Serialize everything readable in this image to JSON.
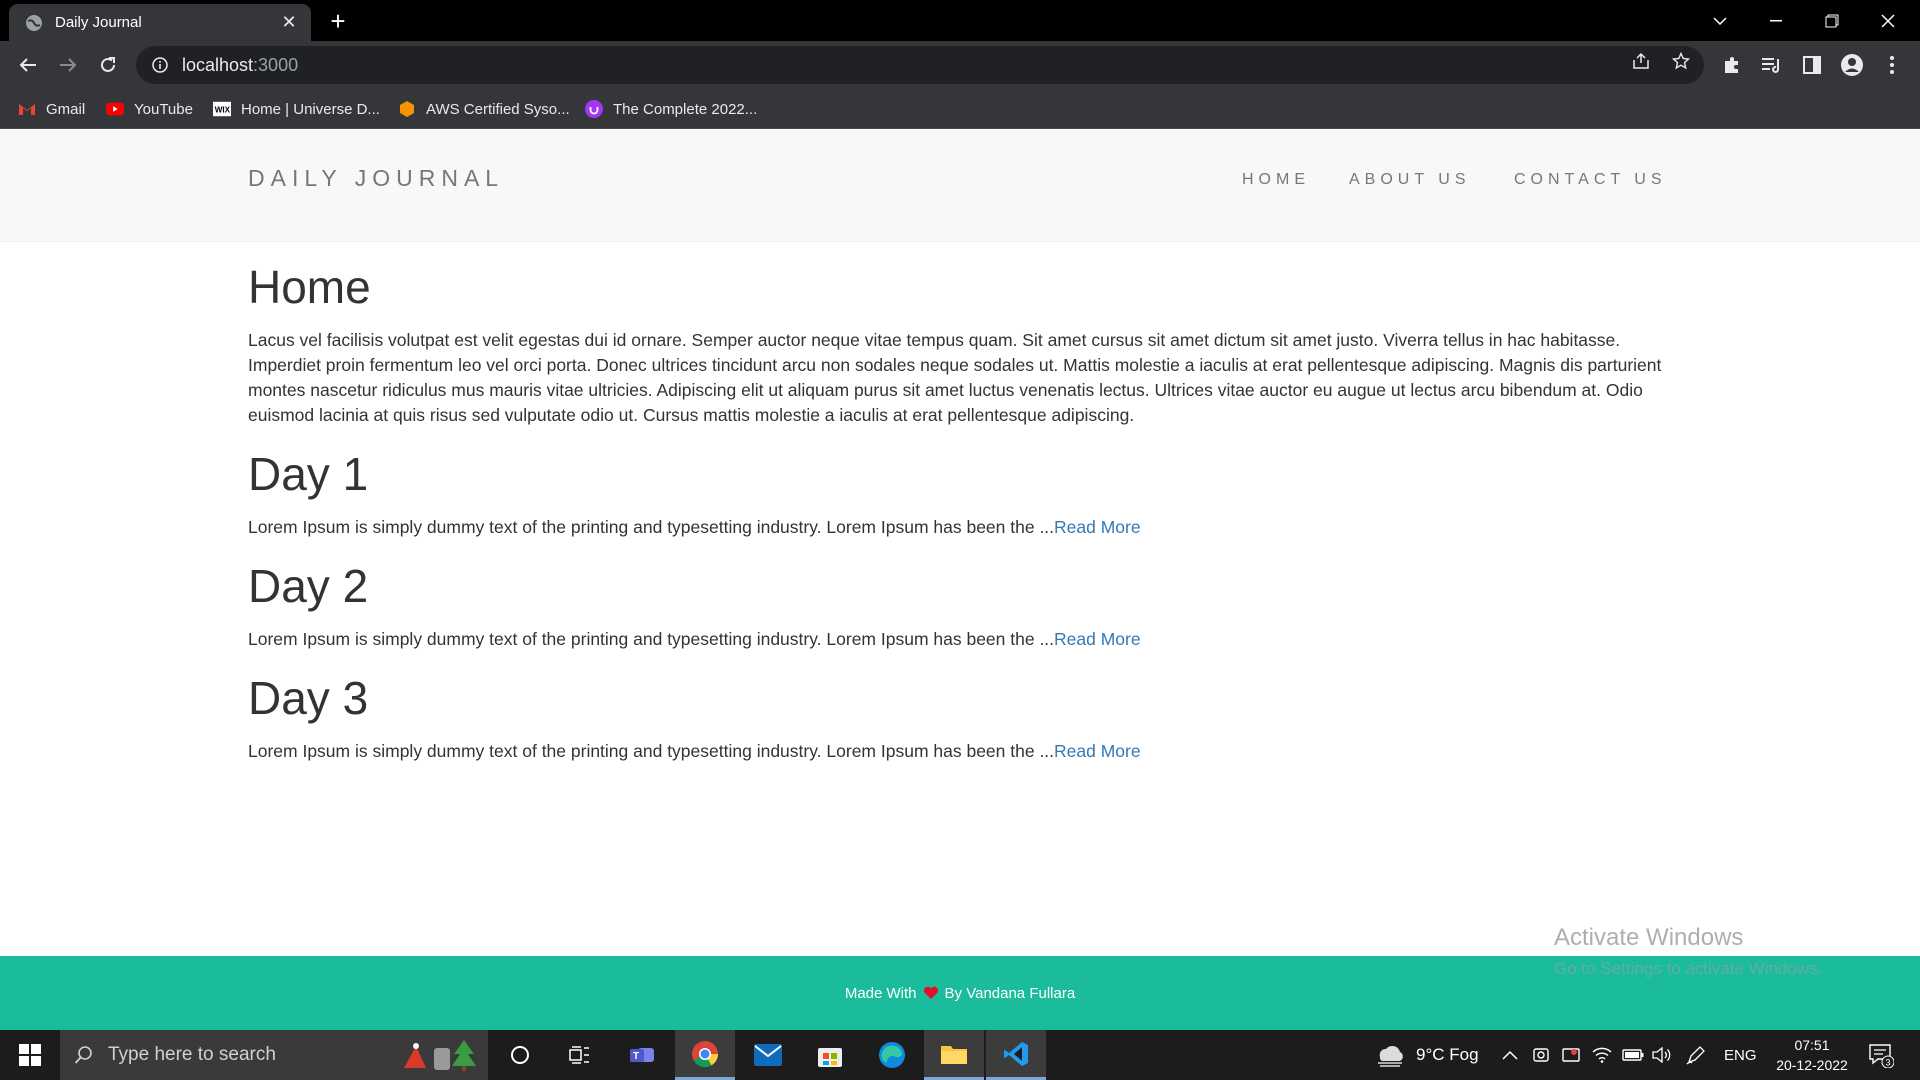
{
  "browser": {
    "tab_title": "Daily Journal",
    "url_host": "localhost",
    "url_port": ":3000",
    "bookmarks": [
      {
        "label": "Gmail",
        "icon": "gmail-icon"
      },
      {
        "label": "YouTube",
        "icon": "youtube-icon"
      },
      {
        "label": "Home | Universe D...",
        "icon": "wix-icon"
      },
      {
        "label": "AWS Certified Syso...",
        "icon": "aws-icon"
      },
      {
        "label": "The Complete 2022...",
        "icon": "udemy-icon"
      }
    ]
  },
  "site": {
    "brand": "DAILY JOURNAL",
    "nav": [
      "HOME",
      "ABOUT US",
      "CONTACT US"
    ],
    "home_title": "Home",
    "home_text": "Lacus vel facilisis volutpat est velit egestas dui id ornare. Semper auctor neque vitae tempus quam. Sit amet cursus sit amet dictum sit amet justo. Viverra tellus in hac habitasse. Imperdiet proin fermentum leo vel orci porta. Donec ultrices tincidunt arcu non sodales neque sodales ut. Mattis molestie a iaculis at erat pellentesque adipiscing. Magnis dis parturient montes nascetur ridiculus mus mauris vitae ultricies. Adipiscing elit ut aliquam purus sit amet luctus venenatis lectus. Ultrices vitae auctor eu augue ut lectus arcu bibendum at. Odio euismod lacinia at quis risus sed vulputate odio ut. Cursus mattis molestie a iaculis at erat pellentesque adipiscing.",
    "posts": [
      {
        "title": "Day 1",
        "excerpt": "Lorem Ipsum is simply dummy text of the printing and typesetting industry. Lorem Ipsum has been the ...",
        "link": "Read More"
      },
      {
        "title": "Day 2",
        "excerpt": "Lorem Ipsum is simply dummy text of the printing and typesetting industry. Lorem Ipsum has been the ...",
        "link": "Read More"
      },
      {
        "title": "Day 3",
        "excerpt": "Lorem Ipsum is simply dummy text of the printing and typesetting industry. Lorem Ipsum has been the ...",
        "link": "Read More"
      }
    ],
    "footer_pre": "Made With",
    "footer_post": "By Vandana Fullara",
    "footer_color": "#1abc9c",
    "link_color": "#337ab7"
  },
  "watermark": {
    "line1": "Activate Windows",
    "line2": "Go to Settings to activate Windows."
  },
  "taskbar": {
    "search_placeholder": "Type here to search",
    "weather": "9°C  Fog",
    "language": "ENG",
    "time": "07:51",
    "date": "20-12-2022",
    "notifications": "3"
  }
}
